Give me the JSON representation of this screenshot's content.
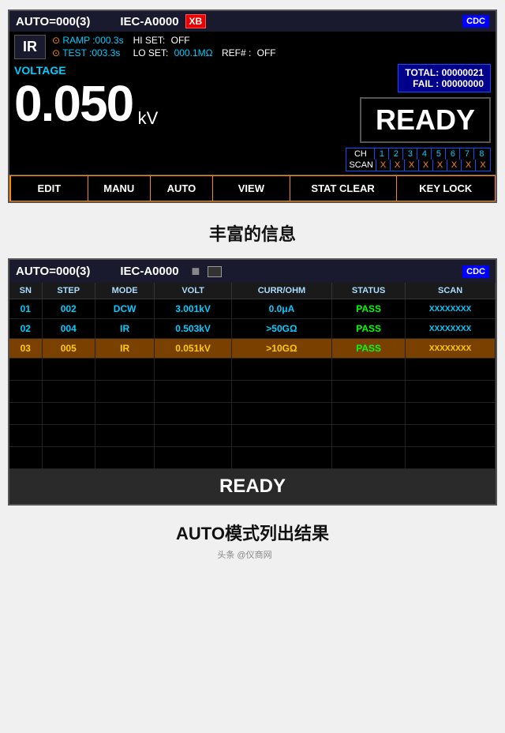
{
  "panel1": {
    "header": {
      "left": "AUTO=000(3)",
      "center": "IEC-A0000",
      "xb": "XB",
      "cdc": "CDC"
    },
    "ir_badge": "IR",
    "ramp_label": "RAMP",
    "ramp_value": ":000.3s",
    "test_label": "TEST",
    "test_value": ":003.3s",
    "hi_set_label": "HI SET:",
    "hi_set_value": "OFF",
    "lo_set_label": "LO SET:",
    "lo_set_value": "000.1MΩ",
    "ref_label": "REF#  :",
    "ref_value": "OFF",
    "voltage_label": "VOLTAGE",
    "voltage_value": "0.050",
    "voltage_unit": "kV",
    "total_label": "TOTAL:",
    "total_value": "00000021",
    "fail_label": "FAIL :",
    "fail_value": "00000000",
    "ready_text": "READY",
    "ch_label": "CH",
    "ch_numbers": [
      "1",
      "2",
      "3",
      "4",
      "5",
      "6",
      "7",
      "8"
    ],
    "scan_label": "SCAN",
    "scan_values": [
      "X",
      "X",
      "X",
      "X",
      "X",
      "X",
      "X",
      "X"
    ],
    "toolbar": {
      "edit": "EDIT",
      "manu": "MANU",
      "auto": "AUTO",
      "view": "VIEW",
      "stat_clear": "STAT CLEAR",
      "key_lock": "KEY LOCK"
    }
  },
  "caption1": "丰富的信息",
  "panel2": {
    "header": {
      "left": "AUTO=000(3)",
      "center": "IEC-A0000",
      "disk": "■",
      "cdc": "CDC"
    },
    "columns": [
      "SN",
      "STEP",
      "MODE",
      "VOLT",
      "CURR/OHM",
      "STATUS",
      "SCAN"
    ],
    "rows": [
      {
        "sn": "01",
        "step": "002",
        "mode": "DCW",
        "volt": "3.001kV",
        "curr": "0.0μA",
        "status": "PASS",
        "scan": "XXXXXXXX",
        "highlight": ""
      },
      {
        "sn": "02",
        "step": "004",
        "mode": "IR",
        "volt": "0.503kV",
        "curr": ">50GΩ",
        "status": "PASS",
        "scan": "XXXXXXXX",
        "highlight": ""
      },
      {
        "sn": "03",
        "step": "005",
        "mode": "IR",
        "volt": "0.051kV",
        "curr": ">10GΩ",
        "status": "PASS",
        "scan": "XXXXXXXX",
        "highlight": "orange"
      }
    ],
    "empty_rows": 5,
    "ready_text": "READY"
  },
  "caption2": "AUTO模式列出结果",
  "caption2_sub": "头条 @仪商网"
}
